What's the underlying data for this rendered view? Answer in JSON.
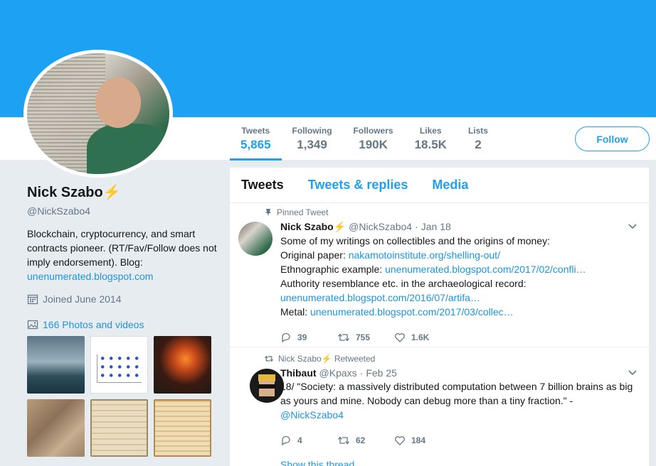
{
  "profile": {
    "name": "Nick Szabo",
    "badge": "⚡",
    "handle": "@NickSzabo4",
    "bio": "Blockchain, cryptocurrency, and smart contracts pioneer. (RT/Fav/Follow does not imply endorsement). Blog:",
    "bio_link": "unenumerated.blogspot.com",
    "joined": "Joined June 2014",
    "photos_label": "166 Photos and videos"
  },
  "stats": [
    {
      "label": "Tweets",
      "value": "5,865"
    },
    {
      "label": "Following",
      "value": "1,349"
    },
    {
      "label": "Followers",
      "value": "190K"
    },
    {
      "label": "Likes",
      "value": "18.5K"
    },
    {
      "label": "Lists",
      "value": "2"
    }
  ],
  "follow_label": "Follow",
  "tabs": [
    "Tweets",
    "Tweets & replies",
    "Media"
  ],
  "tweets": [
    {
      "context": "Pinned Tweet",
      "name": "Nick Szabo",
      "badge": "⚡",
      "handle": "@NickSzabo4",
      "sep": "·",
      "date": "Jan 18",
      "lines": [
        {
          "text": "Some of my writings on collectibles and the origins of money:",
          "link": ""
        },
        {
          "text": "Original paper: ",
          "link": "nakamotoinstitute.org/shelling-out/"
        },
        {
          "text": "Ethnographic example: ",
          "link": "unenumerated.blogspot.com/2017/02/confli…"
        },
        {
          "text": "Authority resemblance etc. in the archaeological record:",
          "link": ""
        },
        {
          "text": "",
          "link": "unenumerated.blogspot.com/2016/07/artifa…"
        },
        {
          "text": "Metal: ",
          "link": "unenumerated.blogspot.com/2017/03/collec…"
        }
      ],
      "replies": "39",
      "retweets": "755",
      "likes": "1.6K"
    },
    {
      "context": "Nick Szabo⚡ Retweeted",
      "name": "Thibaut",
      "badge": "",
      "handle": "@Kpaxs",
      "sep": "·",
      "date": "Feb 25",
      "text": "18/ \"Society: a massively distributed computation between 7 billion brains as big as yours and mine. Nobody can debug more than a tiny fraction.\" - ",
      "mention": "@NickSzabo4",
      "replies": "4",
      "retweets": "62",
      "likes": "184",
      "show_thread": "Show this thread"
    }
  ]
}
